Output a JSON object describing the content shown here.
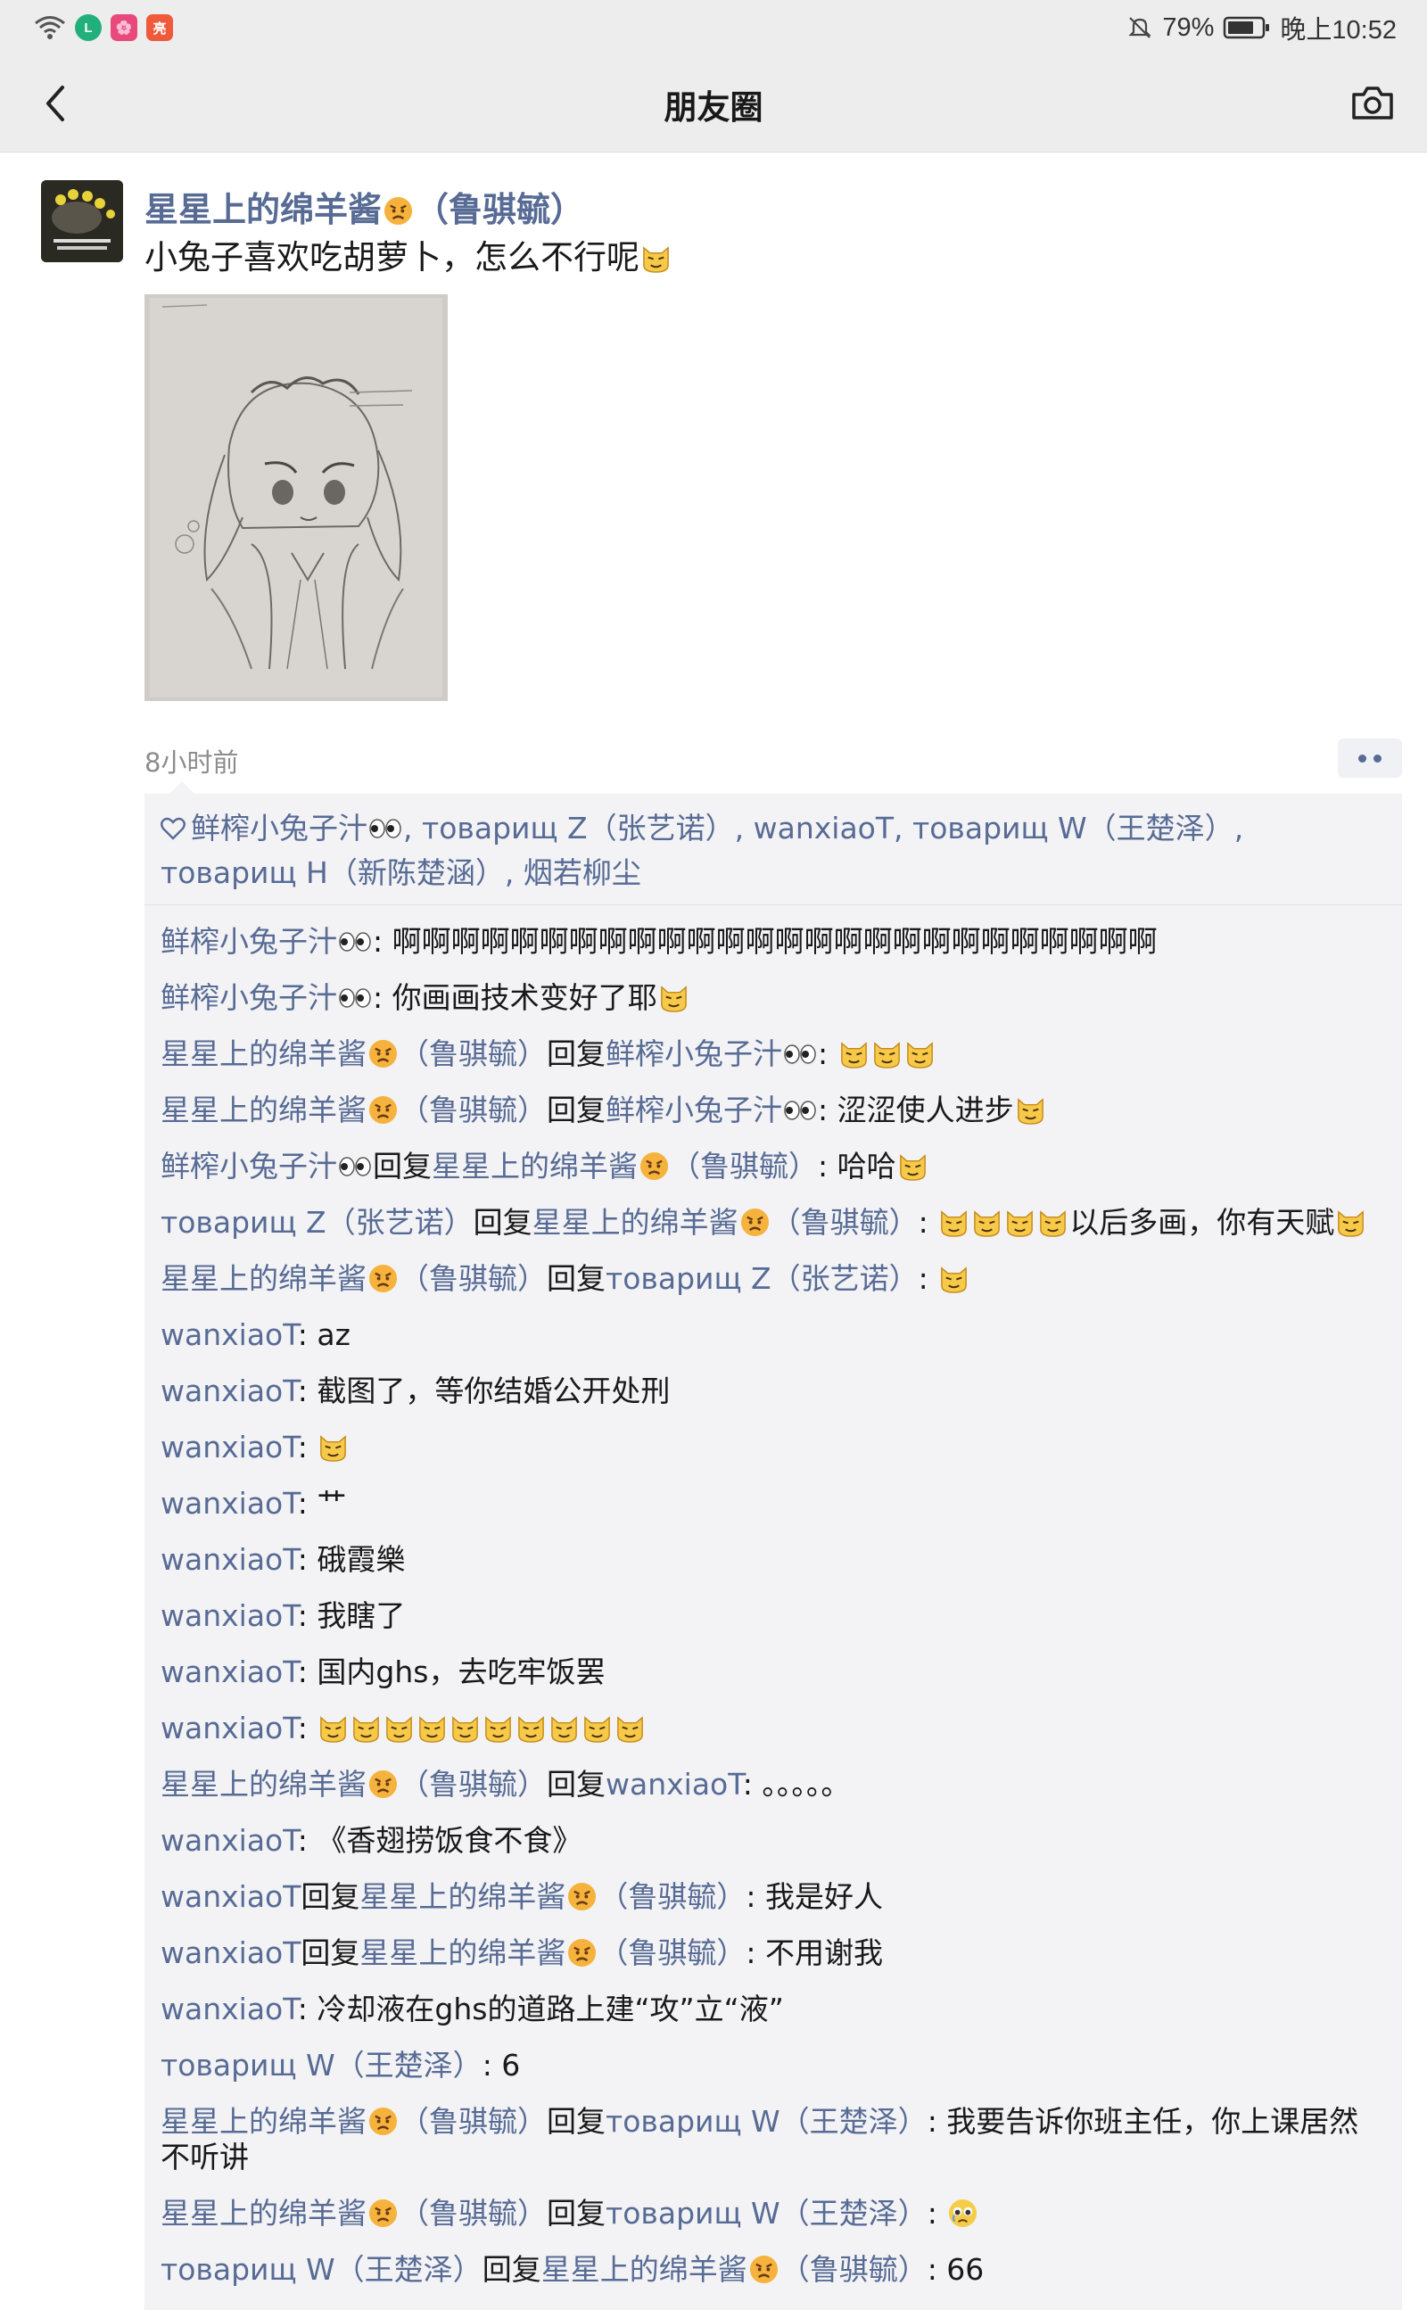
{
  "status_bar": {
    "battery": "79%",
    "time": "晚上10:52",
    "app_badges": [
      "L",
      "🌸",
      "亮"
    ]
  },
  "nav": {
    "title": "朋友圈"
  },
  "post": {
    "author": "星星上的绵羊酱",
    "author_suffix": "（鲁骐毓）",
    "text": "小兔子喜欢吃胡萝卜，怎么不行呢",
    "time": "8小时前"
  },
  "likes": {
    "names": [
      {
        "name": "鲜榨小兔子汁",
        "emoji": "eyes"
      },
      {
        "name": ", товарищ Z（张艺诺）",
        "emoji": ""
      },
      {
        "name": ", wanxiaoT",
        "emoji": ""
      },
      {
        "name": ", товарищ W（王楚泽）",
        "emoji": ""
      },
      {
        "name": ", товарищ H（新陈楚涵）",
        "emoji": ""
      },
      {
        "name": ", 烟若柳尘",
        "emoji": ""
      }
    ]
  },
  "comments": [
    {
      "from": "鲜榨小兔子汁",
      "from_emoji": "eyes",
      "to": "",
      "to_emoji": "",
      "text": "啊啊啊啊啊啊啊啊啊啊啊啊啊啊啊啊啊啊啊啊啊啊啊啊啊啊",
      "text_emoji": []
    },
    {
      "from": "鲜榨小兔子汁",
      "from_emoji": "eyes",
      "to": "",
      "to_emoji": "",
      "text": "你画画技术变好了耶",
      "text_emoji": [
        "cat"
      ]
    },
    {
      "from": "星星上的绵羊酱",
      "from_emoji": "angry",
      "from_suffix": "（鲁骐毓）",
      "to": "鲜榨小兔子汁",
      "to_emoji": "eyes",
      "text": "",
      "text_emoji": [
        "cat",
        "cat",
        "cat"
      ]
    },
    {
      "from": "星星上的绵羊酱",
      "from_emoji": "angry",
      "from_suffix": "（鲁骐毓）",
      "to": "鲜榨小兔子汁",
      "to_emoji": "eyes",
      "text": "涩涩使人进步",
      "text_emoji": [
        "cat"
      ]
    },
    {
      "from": "鲜榨小兔子汁",
      "from_emoji": "eyes",
      "to": "星星上的绵羊酱",
      "to_emoji": "angry",
      "to_suffix": "（鲁骐毓）",
      "text": "哈哈",
      "text_emoji": [
        "cat"
      ]
    },
    {
      "from": "товарищ Z（张艺诺）",
      "from_emoji": "",
      "to": "星星上的绵羊酱",
      "to_emoji": "angry",
      "to_suffix": "（鲁骐毓）",
      "text_pre_emoji": [
        "cat",
        "cat",
        "cat",
        "cat"
      ],
      "text": "以后多画，你有天赋",
      "text_emoji": [
        "cat"
      ]
    },
    {
      "from": "星星上的绵羊酱",
      "from_emoji": "angry",
      "from_suffix": "（鲁骐毓）",
      "to": "товарищ Z（张艺诺）",
      "to_emoji": "",
      "text": "",
      "text_emoji": [
        "cat"
      ]
    },
    {
      "from": "wanxiaoT",
      "from_emoji": "",
      "to": "",
      "to_emoji": "",
      "text": "az",
      "text_emoji": []
    },
    {
      "from": "wanxiaoT",
      "from_emoji": "",
      "to": "",
      "to_emoji": "",
      "text": "截图了，等你结婚公开处刑",
      "text_emoji": []
    },
    {
      "from": "wanxiaoT",
      "from_emoji": "",
      "to": "",
      "to_emoji": "",
      "text": "",
      "text_emoji": [
        "cat"
      ]
    },
    {
      "from": "wanxiaoT",
      "from_emoji": "",
      "to": "",
      "to_emoji": "",
      "text": "艹",
      "text_emoji": []
    },
    {
      "from": "wanxiaoT",
      "from_emoji": "",
      "to": "",
      "to_emoji": "",
      "text": "硪霞樂",
      "text_emoji": []
    },
    {
      "from": "wanxiaoT",
      "from_emoji": "",
      "to": "",
      "to_emoji": "",
      "text": "我瞎了",
      "text_emoji": []
    },
    {
      "from": "wanxiaoT",
      "from_emoji": "",
      "to": "",
      "to_emoji": "",
      "text": "国内ghs，去吃牢饭罢",
      "text_emoji": []
    },
    {
      "from": "wanxiaoT",
      "from_emoji": "",
      "to": "",
      "to_emoji": "",
      "text": "",
      "text_emoji": [
        "cat",
        "cat",
        "cat",
        "cat",
        "cat",
        "cat",
        "cat",
        "cat",
        "cat",
        "cat"
      ]
    },
    {
      "from": "星星上的绵羊酱",
      "from_emoji": "angry",
      "from_suffix": "（鲁骐毓）",
      "to": "wanxiaoT",
      "to_emoji": "",
      "text": "。。。。。",
      "text_emoji": []
    },
    {
      "from": "wanxiaoT",
      "from_emoji": "",
      "to": "",
      "to_emoji": "",
      "text": "《香翅捞饭食不食》",
      "text_emoji": []
    },
    {
      "from": "wanxiaoT",
      "from_emoji": "",
      "to": "星星上的绵羊酱",
      "to_emoji": "angry",
      "to_suffix": "（鲁骐毓）",
      "text": "我是好人",
      "text_emoji": []
    },
    {
      "from": "wanxiaoT",
      "from_emoji": "",
      "to": "星星上的绵羊酱",
      "to_emoji": "angry",
      "to_suffix": "（鲁骐毓）",
      "text": "不用谢我",
      "text_emoji": []
    },
    {
      "from": "wanxiaoT",
      "from_emoji": "",
      "to": "",
      "to_emoji": "",
      "text": "冷却液在ghs的道路上建“攻”立“液”",
      "text_emoji": []
    },
    {
      "from": "товарищ W（王楚泽）",
      "from_emoji": "",
      "to": "",
      "to_emoji": "",
      "text": "6",
      "text_emoji": []
    },
    {
      "from": "星星上的绵羊酱",
      "from_emoji": "angry",
      "from_suffix": "（鲁骐毓）",
      "to": "товарищ W（王楚泽）",
      "to_emoji": "",
      "text": "我要告诉你班主任，你上课居然不听讲",
      "text_emoji": []
    },
    {
      "from": "星星上的绵羊酱",
      "from_emoji": "angry",
      "from_suffix": "（鲁骐毓）",
      "to": "товарищ W（王楚泽）",
      "to_emoji": "",
      "text": "",
      "text_emoji": [
        "tear"
      ]
    },
    {
      "from": "товарищ W（王楚泽）",
      "from_emoji": "",
      "to": "星星上的绵羊酱",
      "to_emoji": "angry",
      "to_suffix": "（鲁骐毓）",
      "text": "66",
      "text_emoji": []
    }
  ],
  "labels": {
    "reply_word": "回复",
    "colon": ": "
  },
  "colors": {
    "link": "#576b95",
    "text": "#191919",
    "box": "#f3f3f5"
  },
  "icons": [
    "back-icon",
    "camera-icon",
    "heart-icon",
    "wifi-icon",
    "bell-muted-icon",
    "battery-icon"
  ]
}
